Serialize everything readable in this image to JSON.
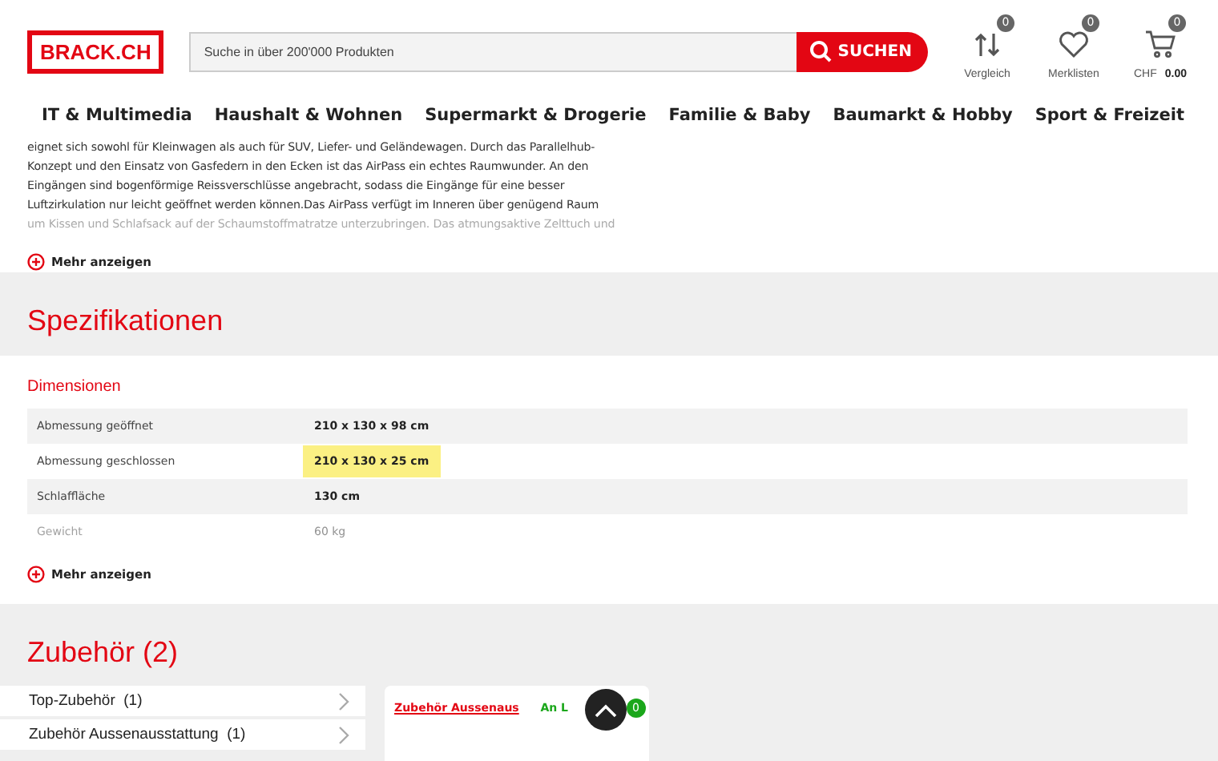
{
  "header": {
    "logo": "BRACK.CH",
    "search": {
      "placeholder": "Suche in über 200'000 Produkten",
      "button": "SUCHEN"
    },
    "actions": [
      {
        "kind": "compare",
        "label": "Vergleich",
        "count": "0"
      },
      {
        "kind": "heart",
        "label": "Merklisten",
        "count": "0"
      },
      {
        "kind": "cart",
        "label": "CHF",
        "amount": "0.00",
        "count": "0"
      }
    ]
  },
  "nav": [
    "IT & Multimedia",
    "Haushalt & Wohnen",
    "Supermarkt & Drogerie",
    "Familie & Baby",
    "Baumarkt & Hobby",
    "Sport & Freizeit"
  ],
  "description": {
    "lines": [
      "eignet sich sowohl für Kleinwagen als auch für SUV, Liefer- und Geländewagen. Durch das Parallelhub-",
      "Konzept und den Einsatz von Gasfedern in den Ecken ist das AirPass ein echtes Raumwunder. An den",
      "Eingängen sind bogenförmige Reissverschlüsse angebracht, sodass die Eingänge für eine besser",
      "Luftzirkulation nur leicht geöffnet werden können.Das AirPass verfügt im Inneren über genügend Raum",
      "um Kissen und Schlafsack auf der Schaumstoffmatratze unterzubringen. Das atmungsaktive Zelttuch und"
    ],
    "more": "Mehr anzeigen"
  },
  "specs": {
    "title": "Spezifikationen",
    "group": "Dimensionen",
    "rows": [
      {
        "label": "Abmessung geöffnet",
        "value": "210 x 130 x 98 cm",
        "highlighted": false,
        "faded": false
      },
      {
        "label": "Abmessung geschlossen",
        "value": "210 x 130 x 25 cm",
        "highlighted": true,
        "faded": false
      },
      {
        "label": "Schlaffläche",
        "value": "130 cm",
        "highlighted": false,
        "faded": false
      },
      {
        "label": "Gewicht",
        "value": "60 kg",
        "highlighted": false,
        "faded": true
      }
    ],
    "more": "Mehr anzeigen"
  },
  "accessories": {
    "title": "Zubehör (2)",
    "categories": [
      {
        "label": "Top-Zubehör",
        "count": "(1)"
      },
      {
        "label": "Zubehör Aussenausstattung",
        "count": "(1)"
      }
    ],
    "card": {
      "link": "Zubehör Aussenaus",
      "stock": "An L",
      "badge": "0"
    }
  }
}
